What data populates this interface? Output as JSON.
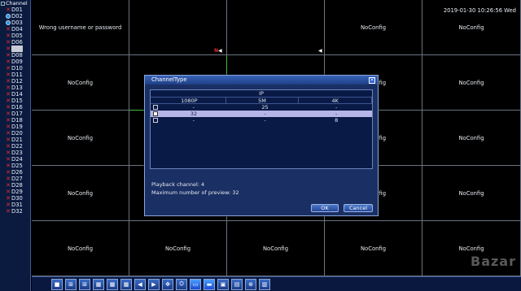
{
  "sidebar": {
    "header": "Channel",
    "channels": [
      {
        "label": "D01",
        "status": "x"
      },
      {
        "label": "D02",
        "status": "on"
      },
      {
        "label": "D03",
        "status": "on"
      },
      {
        "label": "D04",
        "status": "x"
      },
      {
        "label": "D05",
        "status": "x"
      },
      {
        "label": "D06",
        "status": "x"
      },
      {
        "label": "D07",
        "status": "x",
        "selected": true
      },
      {
        "label": "D08",
        "status": "x"
      },
      {
        "label": "D09",
        "status": "x"
      },
      {
        "label": "D10",
        "status": "x"
      },
      {
        "label": "D11",
        "status": "x"
      },
      {
        "label": "D12",
        "status": "x"
      },
      {
        "label": "D13",
        "status": "x"
      },
      {
        "label": "D14",
        "status": "x"
      },
      {
        "label": "D15",
        "status": "x"
      },
      {
        "label": "D16",
        "status": "x"
      },
      {
        "label": "D17",
        "status": "x"
      },
      {
        "label": "D18",
        "status": "x"
      },
      {
        "label": "D19",
        "status": "x"
      },
      {
        "label": "D20",
        "status": "x"
      },
      {
        "label": "D21",
        "status": "x"
      },
      {
        "label": "D22",
        "status": "x"
      },
      {
        "label": "D23",
        "status": "x"
      },
      {
        "label": "D24",
        "status": "x"
      },
      {
        "label": "D25",
        "status": "x"
      },
      {
        "label": "D26",
        "status": "x"
      },
      {
        "label": "D27",
        "status": "x"
      },
      {
        "label": "D28",
        "status": "x"
      },
      {
        "label": "D29",
        "status": "x"
      },
      {
        "label": "D30",
        "status": "x"
      },
      {
        "label": "D31",
        "status": "x"
      },
      {
        "label": "D32",
        "status": "x"
      }
    ]
  },
  "datetime": "2019-01-30 10:26:56 Wed",
  "grid": {
    "cells": [
      "Wrong username or password",
      "",
      "",
      "NoConfig",
      "NoConfig",
      "NoConfig",
      "",
      "",
      "NoConfig",
      "NoConfig",
      "NoConfig",
      "",
      "",
      "NoConfig",
      "NoConfig",
      "NoConfig",
      "",
      "",
      "NoConfig",
      "NoConfig",
      "NoConfig",
      "NoConfig",
      "NoConfig",
      "NoConfig",
      "NoConfig"
    ],
    "marker_n": "N"
  },
  "dialog": {
    "title": "ChannelType",
    "close": "×",
    "group_header": "IP",
    "columns": [
      "1080P",
      "5M",
      "4K"
    ],
    "rows": [
      {
        "values": [
          "-",
          "25",
          "-"
        ],
        "highlight": false
      },
      {
        "values": [
          "32",
          "-",
          "-"
        ],
        "highlight": true
      },
      {
        "values": [
          "-",
          "-",
          "8"
        ],
        "highlight": false
      }
    ],
    "playback": "Playback channel: 4",
    "max_preview": "Maximum number of preview: 32",
    "ok": "OK",
    "cancel": "Cancel"
  },
  "toolbar": {
    "icons": [
      "single-view-icon",
      "quad-view-icon",
      "nine-view-icon",
      "sixteen-view-icon",
      "twentyfive-view-icon",
      "thirtytwo-view-icon",
      "previous-icon",
      "next-icon",
      "ptz-icon",
      "record-icon",
      "playback-icon",
      "display-icon",
      "network-icon",
      "settings-icon",
      "alarm-icon",
      "color-icon"
    ]
  },
  "watermark": "Bazar"
}
